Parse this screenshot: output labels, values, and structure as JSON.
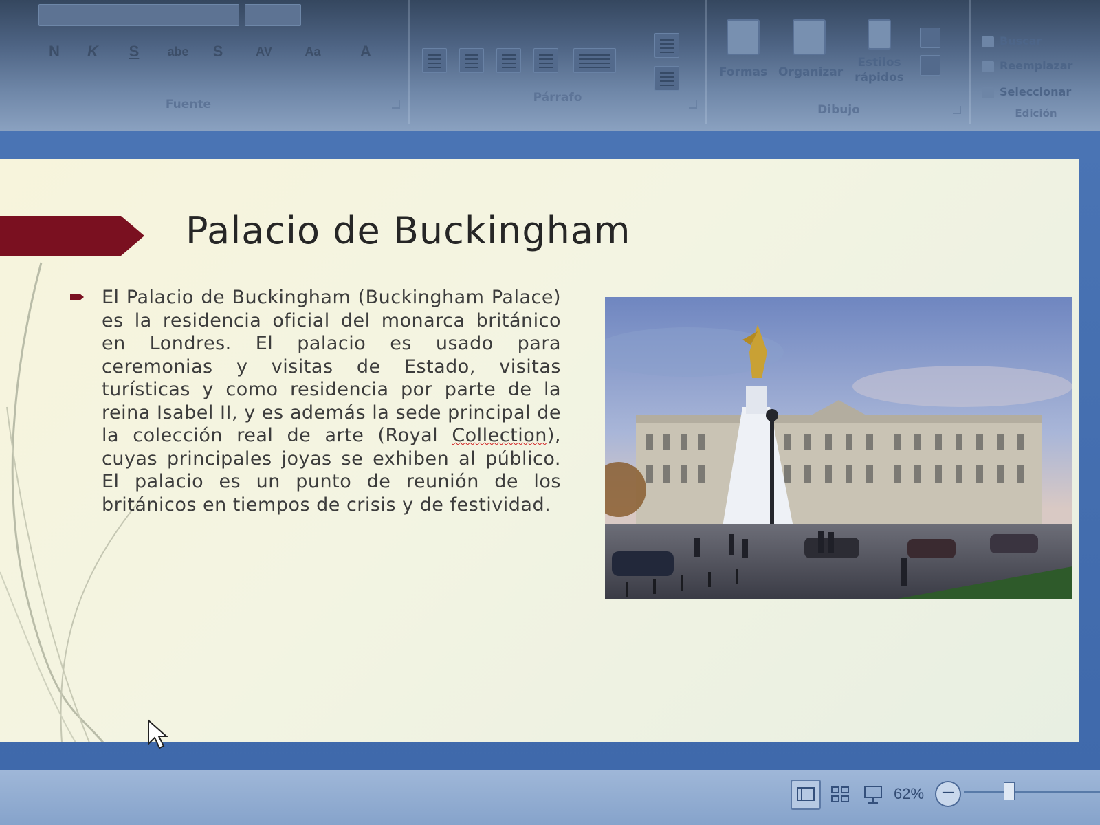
{
  "ribbon": {
    "groups": {
      "font": "Fuente",
      "paragraph": "Párrafo",
      "drawing": "Dibujo",
      "editing": "Edición"
    },
    "font_buttons": [
      "N",
      "K",
      "S",
      "abe",
      "S"
    ],
    "drawing_buttons": {
      "shapes": "Formas",
      "arrange": "Organizar",
      "quick_styles_line1": "Estilos",
      "quick_styles_line2": "rápidos"
    },
    "editing_buttons": {
      "find": "Buscar",
      "replace": "Reemplazar",
      "select": "Seleccionar"
    }
  },
  "slide": {
    "title": "Palacio de Buckingham",
    "body_before": "El Palacio de Buckingham (Buckingham Palace) es la residencia oficial del monarca británico en Londres. El palacio es usado para ceremonias y visitas de Estado, visitas turísticas y como residencia por parte de la reina Isabel II, y es además la sede principal de la colección real de arte (Royal ",
    "body_misspelled": "Collection",
    "body_after": "), cuyas principales joyas se exhiben al público. El palacio es un punto de reunión de los británicos en tiempos de crisis y de festividad.",
    "accent_color": "#7a1020",
    "photo_subject": "buckingham-palace-photo"
  },
  "statusbar": {
    "zoom": "62%",
    "zoom_out_symbol": "−"
  }
}
